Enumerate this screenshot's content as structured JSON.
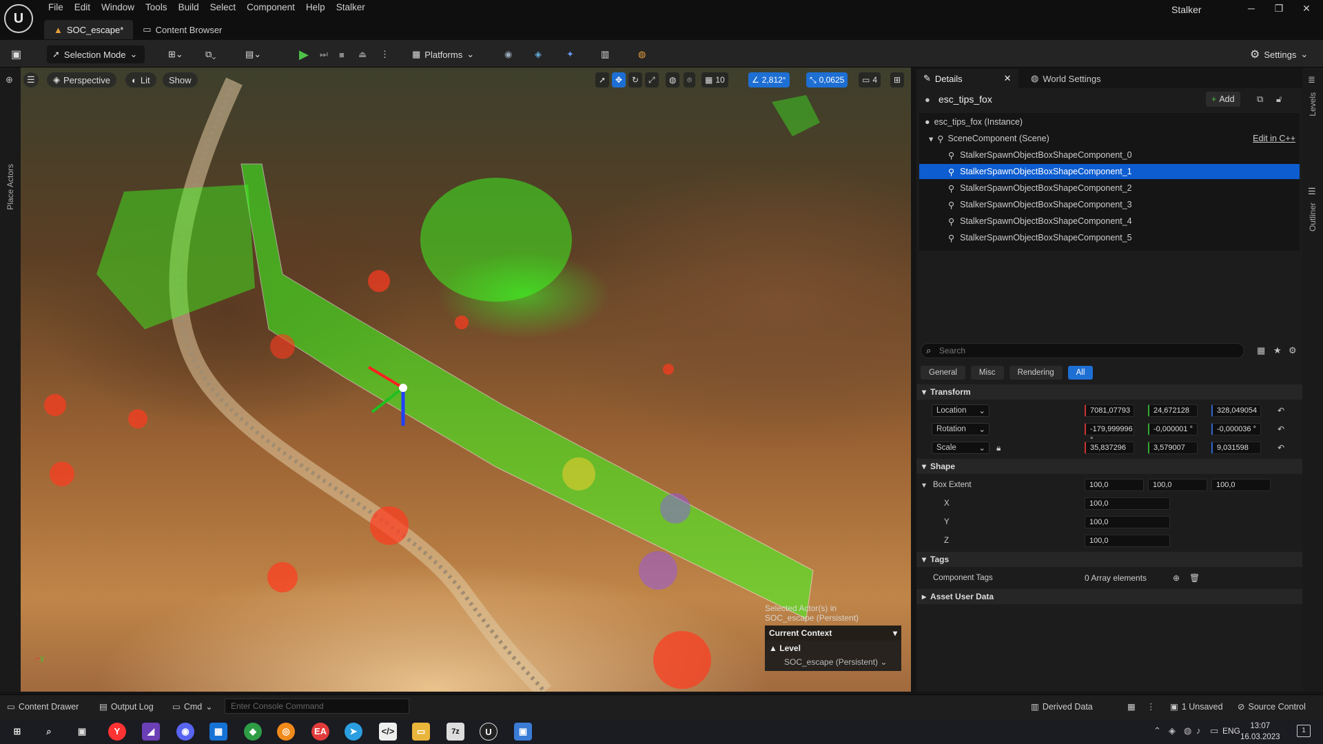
{
  "app": {
    "menu": [
      "File",
      "Edit",
      "Window",
      "Tools",
      "Build",
      "Select",
      "Component",
      "Help",
      "Stalker"
    ],
    "window_title": "Stalker",
    "tabs": [
      "SOC_escape*",
      "Content Browser"
    ]
  },
  "toolbar": {
    "selection_mode": "Selection Mode",
    "platforms": "Platforms",
    "settings": "Settings"
  },
  "left_panel": {
    "label": "Place Actors"
  },
  "viewport": {
    "perspective": "Perspective",
    "lit": "Lit",
    "show": "Show",
    "grid_snap": "10",
    "rotation_snap": "2,812°",
    "scale_snap": "0,0625",
    "camera_speed": "4",
    "context": {
      "selected": "Selected Actor(s) in",
      "selected2": "SOC_escape (Persistent)",
      "current_context": "Current Context",
      "level_label": "Level",
      "level_value": "SOC_escape (Persistent)"
    }
  },
  "details": {
    "tab_details": "Details",
    "tab_world": "World Settings",
    "actor_name": "esc_tips_fox",
    "add": "Add",
    "tree": {
      "root": "esc_tips_fox (Instance)",
      "scene": "SceneComponent (Scene)",
      "edit_cpp": "Edit in C++",
      "items": [
        "StalkerSpawnObjectBoxShapeComponent_0",
        "StalkerSpawnObjectBoxShapeComponent_1",
        "StalkerSpawnObjectBoxShapeComponent_2",
        "StalkerSpawnObjectBoxShapeComponent_3",
        "StalkerSpawnObjectBoxShapeComponent_4",
        "StalkerSpawnObjectBoxShapeComponent_5"
      ]
    },
    "search_placeholder": "Search",
    "filters": [
      "General",
      "Misc",
      "Rendering",
      "All"
    ],
    "transform": {
      "section": "Transform",
      "location_label": "Location",
      "rotation_label": "Rotation",
      "scale_label": "Scale",
      "location": [
        "7081,07793",
        "24,672128",
        "328,049054"
      ],
      "rotation": [
        "-179,999996 °",
        "-0,000001 °",
        "-0,000036 °"
      ],
      "scale": [
        "35,837296",
        "3,579007",
        "9,031598"
      ]
    },
    "shape": {
      "section": "Shape",
      "box_extent_label": "Box Extent",
      "box_extent": [
        "100,0",
        "100,0",
        "100,0"
      ],
      "x_label": "X",
      "y_label": "Y",
      "z_label": "Z",
      "x": "100,0",
      "y": "100,0",
      "z": "100,0"
    },
    "tags": {
      "section": "Tags",
      "component_tags_label": "Component Tags",
      "component_tags_value": "0 Array elements"
    },
    "asset_user_data": "Asset User Data"
  },
  "right_strip": {
    "levels": "Levels",
    "outliner": "Outliner"
  },
  "status": {
    "content_drawer": "Content Drawer",
    "output_log": "Output Log",
    "cmd": "Cmd",
    "console_placeholder": "Enter Console Command",
    "derived_data": "Derived Data",
    "unsaved": "1 Unsaved",
    "source_control": "Source Control"
  },
  "taskbar": {
    "lang": "ENG",
    "time": "13:07",
    "date": "16.03.2023",
    "notification_count": "1"
  }
}
